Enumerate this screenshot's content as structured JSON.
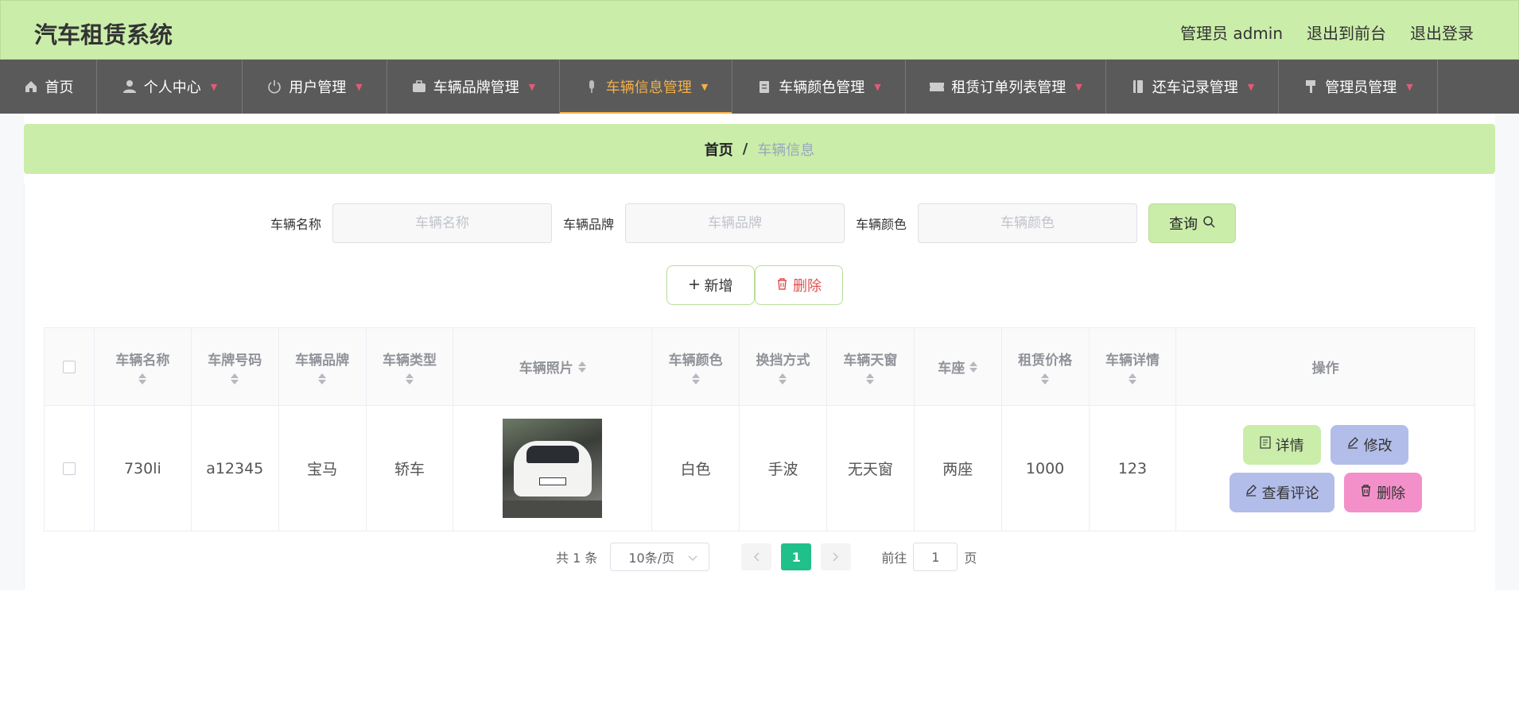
{
  "app": {
    "title": "汽车租赁系统"
  },
  "header": {
    "admin_label": "管理员 admin",
    "front_label": "退出到前台",
    "logout_label": "退出登录"
  },
  "nav": [
    {
      "label": "首页",
      "icon": "home-icon",
      "has_caret": false
    },
    {
      "label": "个人中心",
      "icon": "user-icon",
      "has_caret": true
    },
    {
      "label": "用户管理",
      "icon": "power-icon",
      "has_caret": true
    },
    {
      "label": "车辆品牌管理",
      "icon": "briefcase-icon",
      "has_caret": true
    },
    {
      "label": "车辆信息管理",
      "icon": "microphone-icon",
      "has_caret": true,
      "active": true
    },
    {
      "label": "车辆颜色管理",
      "icon": "clipboard-icon",
      "has_caret": true
    },
    {
      "label": "租赁订单列表管理",
      "icon": "ticket-icon",
      "has_caret": true
    },
    {
      "label": "还车记录管理",
      "icon": "notebook-icon",
      "has_caret": true
    },
    {
      "label": "管理员管理",
      "icon": "brush-icon",
      "has_caret": true
    }
  ],
  "breadcrumb": {
    "home": "首页",
    "separator": "/",
    "current": "车辆信息"
  },
  "search": {
    "name_label": "车辆名称",
    "name_placeholder": "车辆名称",
    "brand_label": "车辆品牌",
    "brand_placeholder": "车辆品牌",
    "color_label": "车辆颜色",
    "color_placeholder": "车辆颜色",
    "query_label": "查询"
  },
  "actions": {
    "add_label": "新增",
    "delete_label": "删除"
  },
  "table": {
    "columns": [
      "车辆名称",
      "车牌号码",
      "车辆品牌",
      "车辆类型",
      "车辆照片",
      "车辆颜色",
      "换挡方式",
      "车辆天窗",
      "车座",
      "租赁价格",
      "车辆详情",
      "操作"
    ],
    "rows": [
      {
        "name": "730li",
        "plate": "a12345",
        "brand": "宝马",
        "type": "轿车",
        "color": "白色",
        "gear": "手波",
        "sunroof": "无天窗",
        "seats": "两座",
        "price": "1000",
        "detail": "123"
      }
    ],
    "row_actions": {
      "detail": "详情",
      "edit": "修改",
      "review": "查看评论",
      "remove": "删除"
    }
  },
  "pagination": {
    "total_text": "共 1 条",
    "page_size": "10条/页",
    "current_page": "1",
    "goto_prefix": "前往",
    "goto_value": "1",
    "goto_suffix": "页"
  },
  "colors": {
    "accent_green": "#caedaa",
    "nav_bg": "#5a5a5a",
    "active_nav": "#f2b04a",
    "page_active": "#20c08a",
    "edit_btn": "#b3bde9",
    "remove_btn": "#f390c9"
  }
}
